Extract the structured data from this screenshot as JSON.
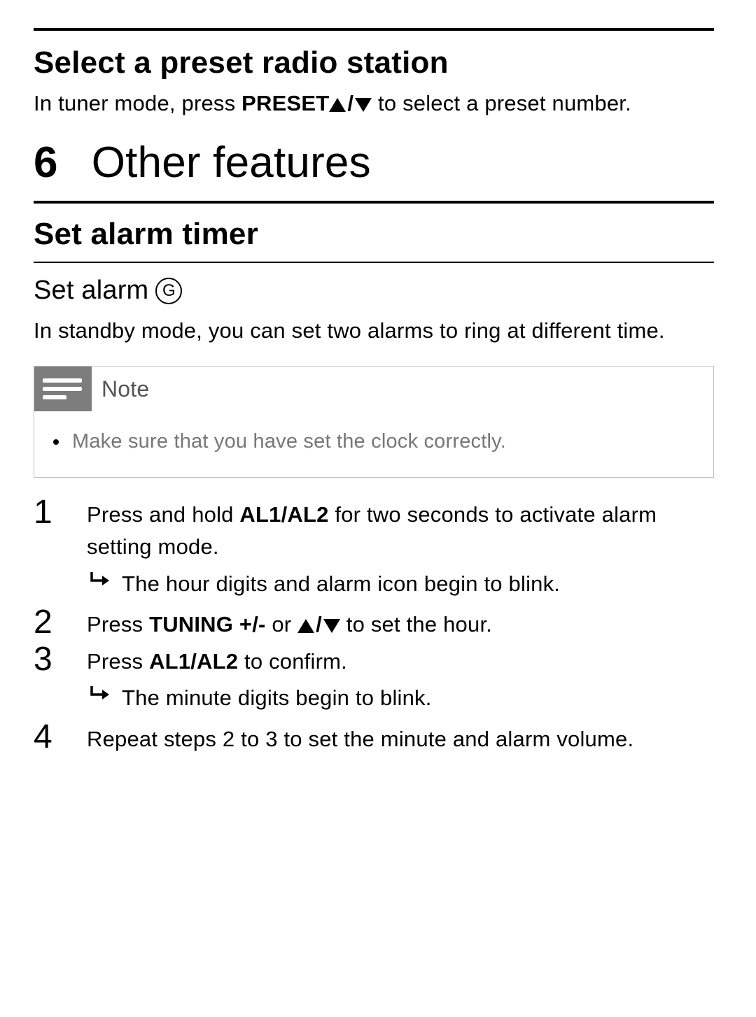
{
  "section_preset": {
    "title": "Select a preset radio station",
    "intro_pre": "In tuner mode, press ",
    "intro_bold": "PRESET",
    "intro_post": " to select a preset number."
  },
  "chapter": {
    "number": "6",
    "title": "Other features"
  },
  "section_alarm": {
    "title": "Set alarm timer",
    "subtitle": "Set alarm",
    "subtitle_marker": "G",
    "intro": "In standby mode, you can set two alarms to ring at different time."
  },
  "note": {
    "label": "Note",
    "items": [
      "Make sure that you have set the clock correctly."
    ]
  },
  "steps": [
    {
      "num": "1",
      "parts": [
        {
          "t": "Press and hold "
        },
        {
          "t": "AL1/AL2",
          "bold": true
        },
        {
          "t": " for two seconds to activate alarm setting mode."
        }
      ],
      "result": "The hour digits and alarm icon begin to blink."
    },
    {
      "num": "2",
      "parts": [
        {
          "t": "Press "
        },
        {
          "t": "TUNING +/-",
          "bold": true
        },
        {
          "t": " or "
        },
        {
          "t": "",
          "tri": true
        },
        {
          "t": " to set the hour."
        }
      ]
    },
    {
      "num": "3",
      "parts": [
        {
          "t": "Press "
        },
        {
          "t": "AL1/AL2",
          "bold": true
        },
        {
          "t": " to confirm."
        }
      ],
      "result": "The minute digits begin to blink."
    },
    {
      "num": "4",
      "parts": [
        {
          "t": "Repeat steps 2 to 3 to set the minute and alarm volume."
        }
      ]
    }
  ]
}
